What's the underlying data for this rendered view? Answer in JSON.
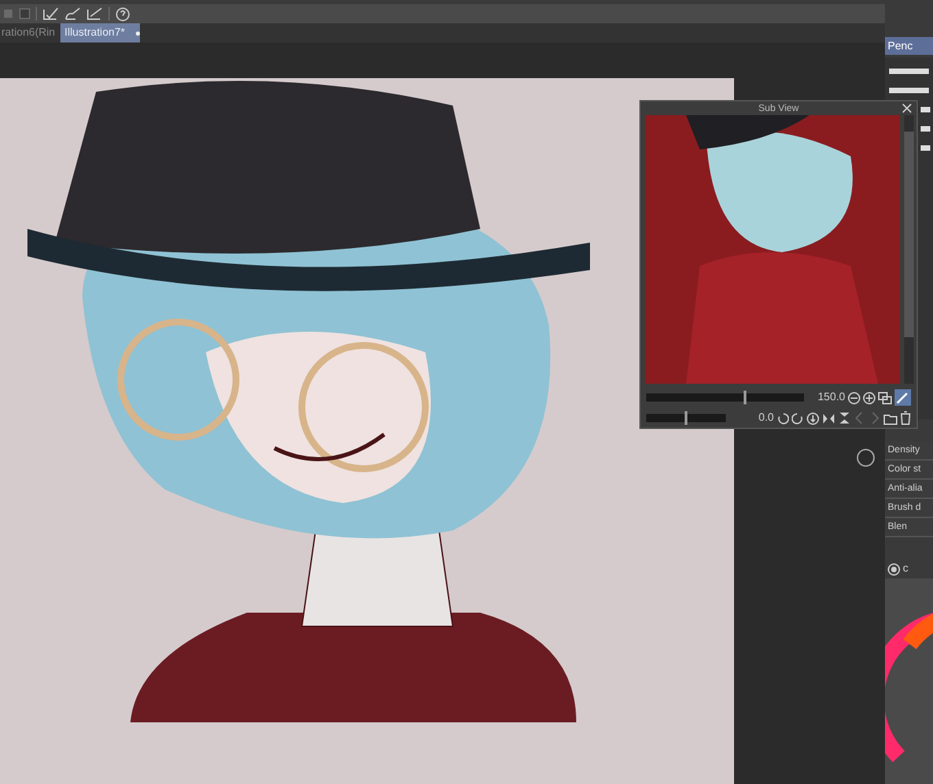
{
  "document_tabs": [
    {
      "label": "ration6(Rin",
      "selected": false
    },
    {
      "label": "Illustration7*",
      "selected": true
    }
  ],
  "tool_panel": {
    "items": [
      {
        "label": "Penc",
        "selected": true
      }
    ]
  },
  "sub_view": {
    "title": "Sub View",
    "zoom": {
      "value": "150.0",
      "level": 0.63
    },
    "rotation": {
      "value": "0.0",
      "level": 0.5
    }
  },
  "brush_properties": [
    {
      "label": "Density"
    },
    {
      "label": "Color st"
    },
    {
      "label": "Anti-alia"
    },
    {
      "label": "Brush d"
    },
    {
      "label": "Blen"
    }
  ],
  "color_panel": {
    "tab": "c"
  }
}
